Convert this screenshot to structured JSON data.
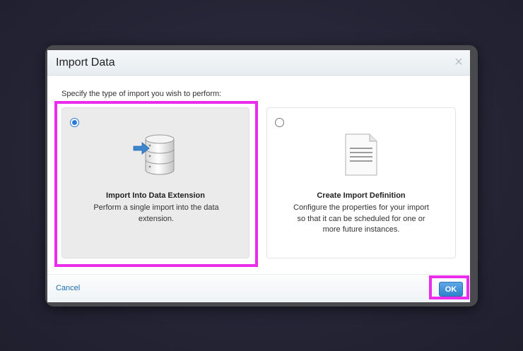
{
  "dialog": {
    "title": "Import Data",
    "close_glyph": "×",
    "instruction": "Specify the type of import you wish to perform:",
    "options": [
      {
        "title": "Import Into Data Extension",
        "description": "Perform a single import into the data extension.",
        "selected": true,
        "icon": "database-import-icon"
      },
      {
        "title": "Create Import Definition",
        "description": "Configure the properties for your import so that it can be scheduled for one or more future instances.",
        "selected": false,
        "icon": "document-icon"
      }
    ],
    "footer": {
      "cancel_label": "Cancel",
      "ok_label": "OK"
    }
  },
  "colors": {
    "highlight": "#ec2ced",
    "link": "#1b6db3",
    "ok_button": "#3a8bd3",
    "selected_card": "#ebebeb"
  }
}
